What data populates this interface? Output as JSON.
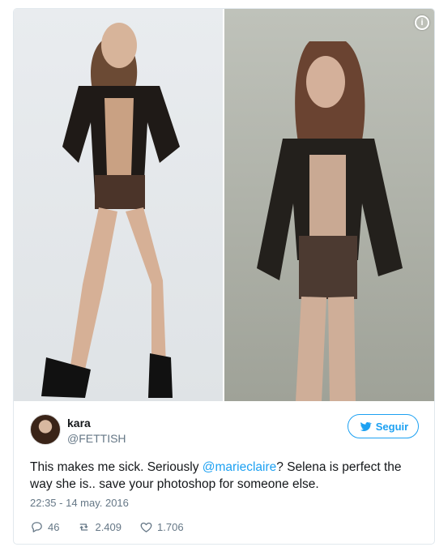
{
  "tweet": {
    "author_name": "kara",
    "author_handle": "@FETTISH",
    "follow_label": "Seguir",
    "text_before": "This makes me sick. Seriously ",
    "mention": "@marieclaire",
    "text_after": "? Selena is perfect the way she is.. save your photoshop for someone else.",
    "timestamp": "22:35 - 14 may. 2016",
    "replies": "46",
    "retweets": "2.409",
    "likes": "1.706",
    "info_icon": "i"
  },
  "colors": {
    "accent": "#1da1f2",
    "muted": "#657786",
    "text": "#14171a",
    "border": "#e1e8ed"
  },
  "icons": {
    "reply": "reply-icon",
    "retweet": "retweet-icon",
    "like": "heart-icon",
    "follow": "twitter-bird-icon",
    "info": "info-icon"
  }
}
